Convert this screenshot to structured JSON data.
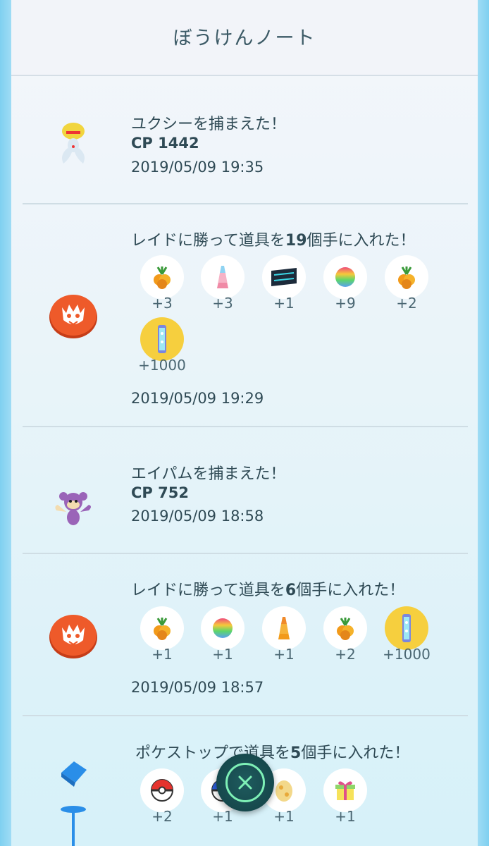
{
  "header": {
    "title": "ぼうけんノート"
  },
  "entries": [
    {
      "type": "catch",
      "title": "ユクシーを捕まえた！",
      "cp": "CP 1442",
      "date": "2019/05/09 19:35",
      "icon": "uxie-pokemon-icon"
    },
    {
      "type": "raid",
      "title_pre": "レイドに勝って道具を",
      "title_num": "19",
      "title_post": "個手に入れた！",
      "date": "2019/05/09 19:29",
      "icon": "raid-egg-icon",
      "items": [
        {
          "name": "golden-razz-berry-icon",
          "qty": "+3"
        },
        {
          "name": "rare-candy-icon",
          "qty": "+3"
        },
        {
          "name": "tm-icon",
          "qty": "+1"
        },
        {
          "name": "pinap-berry-icon",
          "qty": "+9"
        },
        {
          "name": "golden-razz-berry-icon",
          "qty": "+2"
        },
        {
          "name": "stardust-icon",
          "qty": "+1000"
        }
      ]
    },
    {
      "type": "catch",
      "title": "エイパムを捕まえた！",
      "cp": "CP 752",
      "date": "2019/05/09 18:58",
      "icon": "aipom-pokemon-icon"
    },
    {
      "type": "raid",
      "title_pre": "レイドに勝って道具を",
      "title_num": "6",
      "title_post": "個手に入れた！",
      "date": "2019/05/09 18:57",
      "icon": "raid-egg-icon",
      "items": [
        {
          "name": "golden-razz-berry-icon",
          "qty": "+1"
        },
        {
          "name": "pinap-berry-icon",
          "qty": "+1"
        },
        {
          "name": "rare-candy-icon",
          "qty": "+1"
        },
        {
          "name": "golden-razz-berry-icon",
          "qty": "+2"
        },
        {
          "name": "stardust-icon",
          "qty": "+1000"
        }
      ]
    },
    {
      "type": "pokestop",
      "title_pre": "ポケストップで道具を",
      "title_num": "5",
      "title_post": "個手に入れた！",
      "icon": "pokestop-icon",
      "items": [
        {
          "name": "poke-ball-icon",
          "qty": "+2"
        },
        {
          "name": "great-ball-icon",
          "qty": "+1"
        },
        {
          "name": "egg-icon",
          "qty": "+1"
        },
        {
          "name": "gift-icon",
          "qty": "+1"
        }
      ]
    }
  ],
  "close_button": {
    "icon": "close-icon"
  },
  "colors": {
    "accent": "#7ef0b6",
    "raid": "#e8572a",
    "text": "#2f4a55",
    "gold": "#f6cf3e"
  }
}
